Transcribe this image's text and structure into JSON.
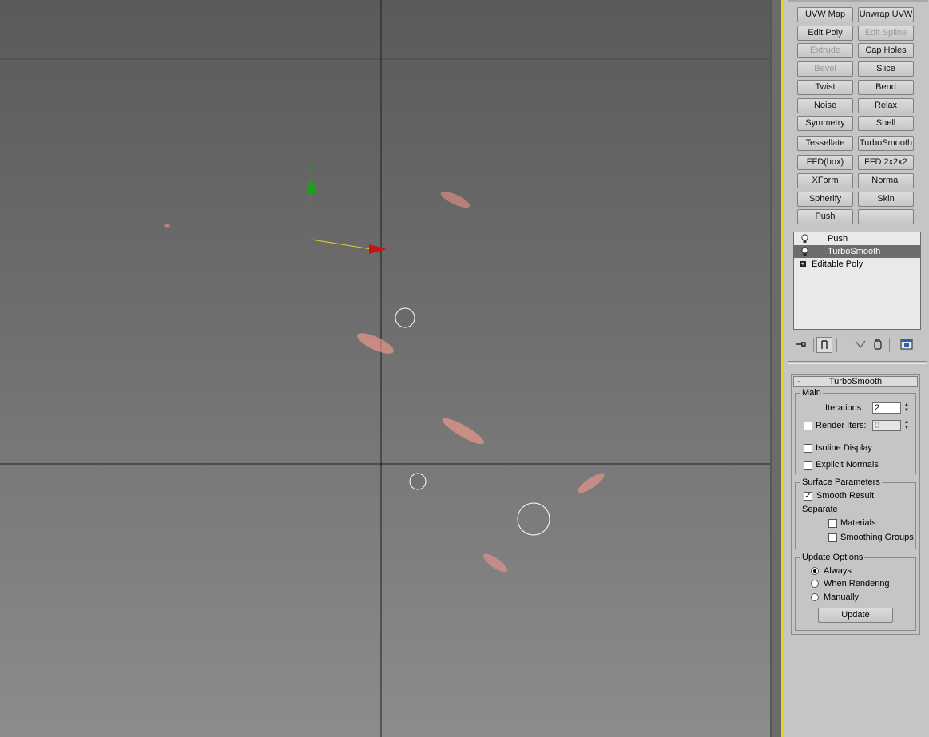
{
  "viewport": {
    "mesh_color": "#b33a2e",
    "wire_color": "#ffffff",
    "gizmo_y_color": "#1aa31a",
    "gizmo_x_color": "#cc1111"
  },
  "modifier_buttons": [
    {
      "label": "UVW Map",
      "enabled": true
    },
    {
      "label": "Unwrap UVW",
      "enabled": true
    },
    {
      "label": "Edit Poly",
      "enabled": true
    },
    {
      "label": "Edit Spline",
      "enabled": false
    },
    {
      "label": "Extrude",
      "enabled": false
    },
    {
      "label": "Cap Holes",
      "enabled": true
    },
    {
      "label": "Bevel",
      "enabled": false
    },
    {
      "label": "Slice",
      "enabled": true
    },
    {
      "label": "Twist",
      "enabled": true
    },
    {
      "label": "Bend",
      "enabled": true
    },
    {
      "label": "Noise",
      "enabled": true
    },
    {
      "label": "Relax",
      "enabled": true
    },
    {
      "label": "Symmetry",
      "enabled": true
    },
    {
      "label": "Shell",
      "enabled": true
    },
    {
      "label": "Tessellate",
      "enabled": true
    },
    {
      "label": "TurboSmooth",
      "enabled": true
    },
    {
      "label": "FFD(box)",
      "enabled": true
    },
    {
      "label": "FFD 2x2x2",
      "enabled": true
    },
    {
      "label": "XForm",
      "enabled": true
    },
    {
      "label": "Normal",
      "enabled": true
    },
    {
      "label": "Spherify",
      "enabled": true
    },
    {
      "label": "Skin",
      "enabled": true
    },
    {
      "label": "Push",
      "enabled": true
    },
    {
      "label": "",
      "enabled": true
    }
  ],
  "stack": {
    "items": [
      {
        "label": "Push",
        "icon": "lightbulb-icon"
      },
      {
        "label": "TurboSmooth",
        "icon": "lightbulb-icon",
        "selected": true
      },
      {
        "label": "Editable Poly",
        "icon": "expand-plus-icon"
      }
    ],
    "toolbar_icons": [
      "pin-stack-icon",
      "show-end-result-icon",
      "make-unique-icon",
      "remove-modifier-icon",
      "configure-modifier-sets-icon"
    ]
  },
  "turbosmooth": {
    "title": "TurboSmooth",
    "collapse_symbol": "-",
    "main": {
      "group_label": "Main",
      "iterations_label": "Iterations:",
      "iterations_value": "2",
      "render_iters_label": "Render Iters:",
      "render_iters_value": "0",
      "render_iters_checked": false,
      "isoline_label": "Isoline Display",
      "isoline_checked": false,
      "explicit_normals_label": "Explicit Normals",
      "explicit_normals_checked": false
    },
    "surface": {
      "group_label": "Surface Parameters",
      "smooth_result_label": "Smooth Result",
      "smooth_result_checked": true,
      "separate_label": "Separate",
      "materials_label": "Materials",
      "materials_checked": false,
      "smoothing_groups_label": "Smoothing Groups",
      "smoothing_groups_checked": false
    },
    "update": {
      "group_label": "Update Options",
      "options": [
        "Always",
        "When Rendering",
        "Manually"
      ],
      "selected": "Always",
      "button_label": "Update"
    }
  }
}
